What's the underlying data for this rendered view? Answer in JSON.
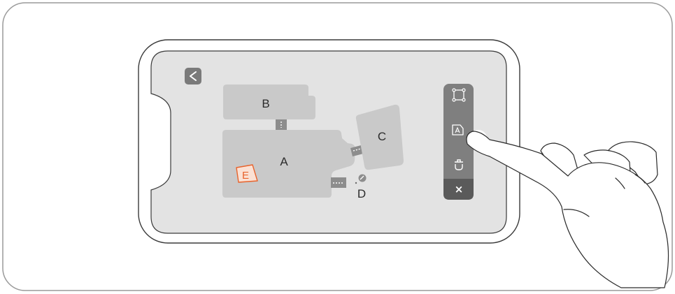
{
  "map": {
    "rooms": [
      {
        "id": "A",
        "label": "A"
      },
      {
        "id": "B",
        "label": "B"
      },
      {
        "id": "C",
        "label": "C"
      },
      {
        "id": "D",
        "label": "D"
      },
      {
        "id": "E",
        "label": "E"
      }
    ],
    "highlighted_room": "E",
    "highlight_color": "#e8632c"
  },
  "toolbar": {
    "tools": [
      {
        "icon": "select-area-icon"
      },
      {
        "icon": "rename-room-icon"
      },
      {
        "icon": "delete-icon"
      }
    ],
    "close_glyph": "×"
  },
  "colors": {
    "screen": "#e3e3e3",
    "room": "#c9c9c9",
    "toolbar": "#7f7f7f",
    "toolbar_close": "#5a5a5a",
    "back_button": "#7a7a7a"
  }
}
